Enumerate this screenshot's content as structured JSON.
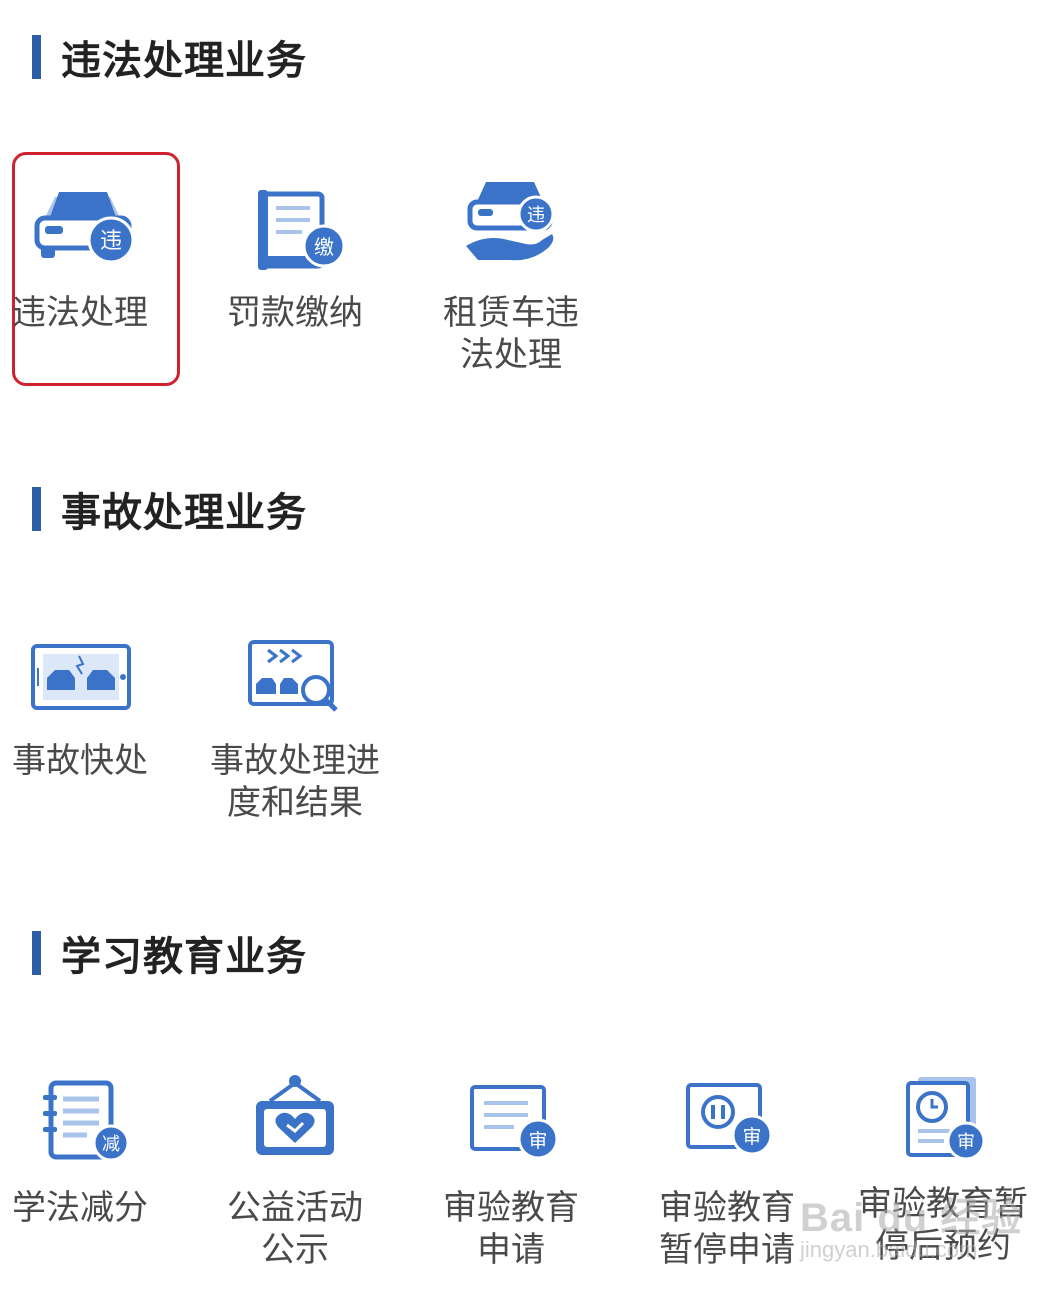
{
  "sections": [
    {
      "title": "违法处理业务",
      "items": [
        {
          "label": "违法处理",
          "icon": "car-violation-icon",
          "badge": "违"
        },
        {
          "label": "罚款缴纳",
          "icon": "document-pay-icon",
          "badge": "缴"
        },
        {
          "label": "租赁车违\n法处理",
          "icon": "rental-car-hand-icon",
          "badge": "违"
        }
      ]
    },
    {
      "title": "事故处理业务",
      "items": [
        {
          "label": "事故快处",
          "icon": "car-collision-phone-icon"
        },
        {
          "label": "事故处理进\n度和结果",
          "icon": "accident-search-icon"
        }
      ]
    },
    {
      "title": "学习教育业务",
      "items": [
        {
          "label": "学法减分",
          "icon": "notebook-icon",
          "badge": "减"
        },
        {
          "label": "公益活动\n公示",
          "icon": "heart-board-icon"
        },
        {
          "label": "审验教育\n申请",
          "icon": "review-document-icon",
          "badge": "审"
        },
        {
          "label": "审验教育\n暂停申请",
          "icon": "pause-document-icon",
          "badge": "审"
        },
        {
          "label": "审验教育暂\n停后预约",
          "icon": "clock-document-icon",
          "badge": "审"
        }
      ]
    }
  ],
  "watermark": {
    "logo": "Bai du 经验",
    "sub": "jingyan.baidu.com"
  },
  "colors": {
    "accent": "#2e5ea6",
    "icon_blue": "#3b73c8",
    "icon_light": "#a9c4ea",
    "highlight": "#d0212e"
  }
}
